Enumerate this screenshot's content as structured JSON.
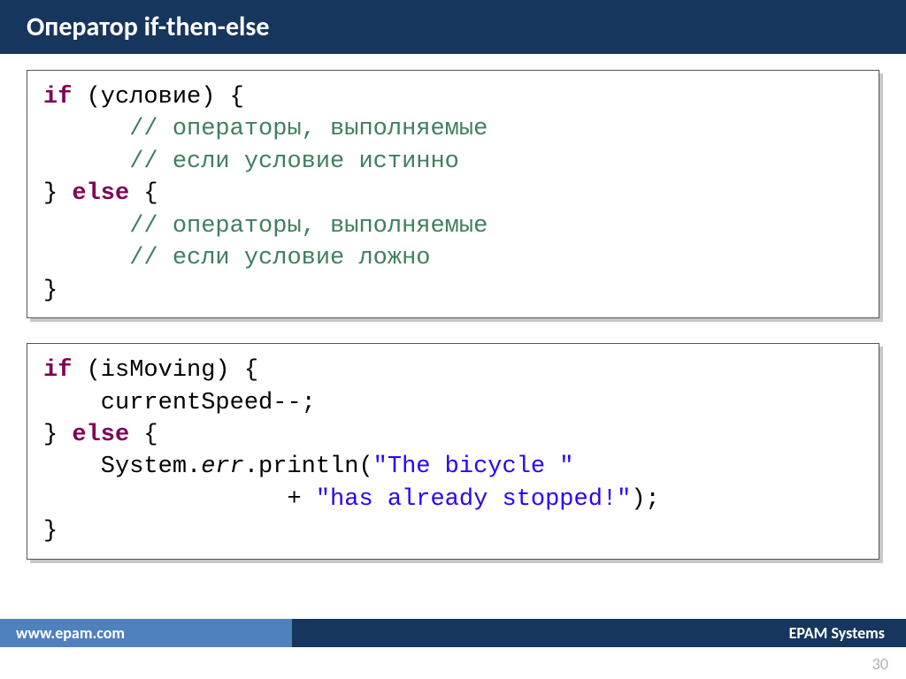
{
  "header": {
    "title": "Оператор if-then-else"
  },
  "code1": {
    "l1a": "if",
    "l1b": " (условие) {",
    "l2": "      // операторы, выполняемые",
    "l3": "      // если условие истинно",
    "l4a": "} ",
    "l4b": "else",
    "l4c": " {",
    "l5": "      // операторы, выполняемые",
    "l6": "      // если условие ложно",
    "l7": "}"
  },
  "code2": {
    "l1a": "if",
    "l1b": " (isMoving) {",
    "l2": "    currentSpeed--;",
    "l3a": "} ",
    "l3b": "else",
    "l3c": " {",
    "l4a": "    System.",
    "l4b": "err",
    "l4c": ".println(",
    "l4d": "\"The bicycle \"",
    "l5a": "                 + ",
    "l5b": "\"has already stopped!\"",
    "l5c": ");",
    "l6": "}"
  },
  "footer": {
    "url": "www.epam.com",
    "company": "EPAM Systems"
  },
  "page": "30"
}
